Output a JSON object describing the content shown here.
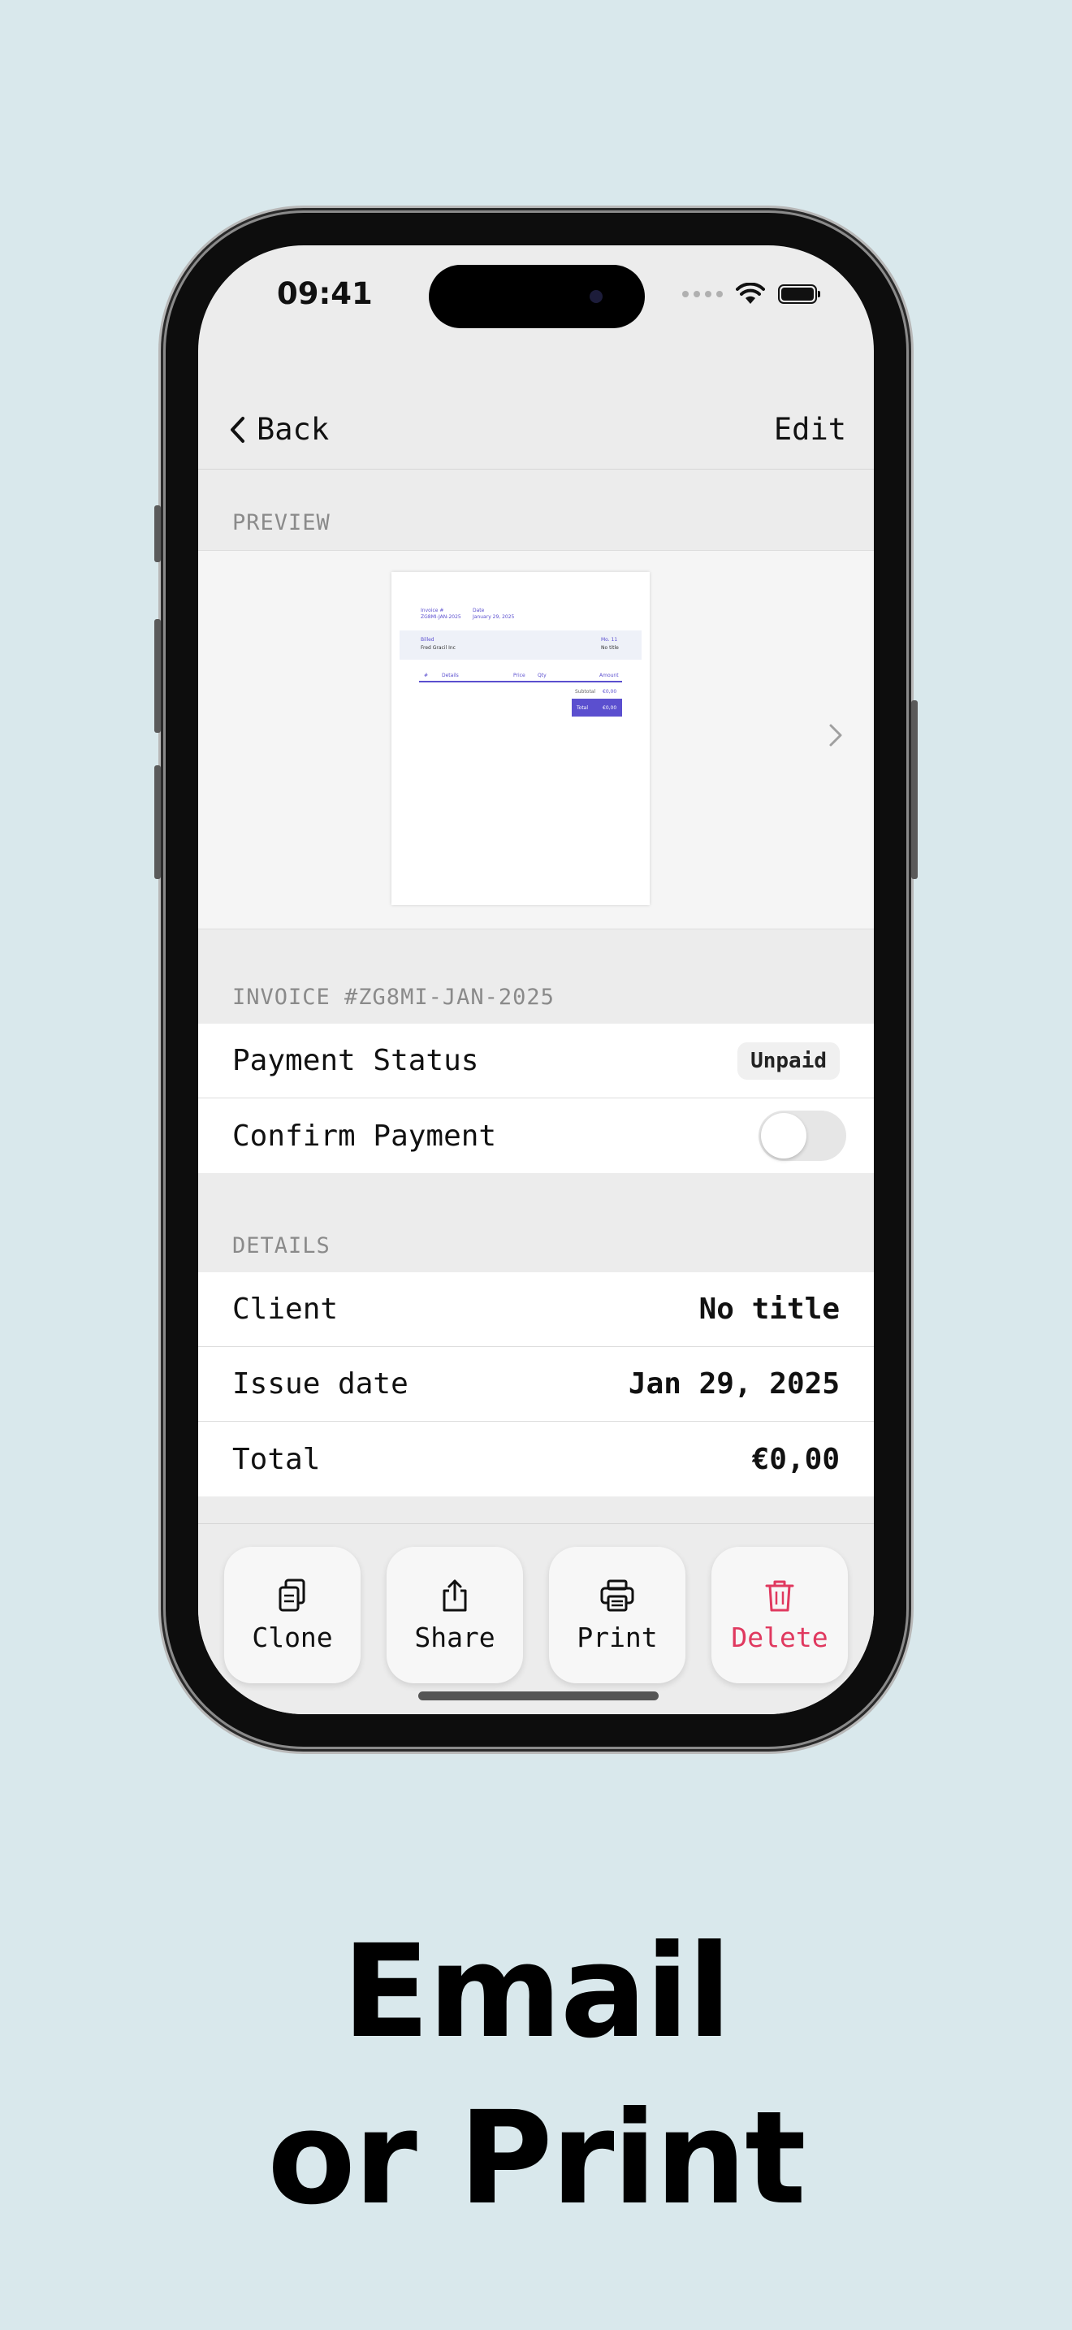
{
  "status_bar": {
    "time": "09:41"
  },
  "nav": {
    "back_label": "Back",
    "edit_label": "Edit"
  },
  "preview": {
    "section_label": "PREVIEW",
    "doc": {
      "invoice_label": "Invoice #",
      "invoice_number": "ZG8MI-JAN-2025",
      "date_label": "Date",
      "date_value": "January 29, 2025",
      "bill_label": "Billed",
      "bill_to": "Fred Gracil Inc",
      "right_top": "Mo. 11",
      "right_sub": "No title",
      "col_num": "#",
      "col_details": "Details",
      "col_price": "Price",
      "col_qty": "Qty",
      "col_amount": "Amount",
      "subtotal_label": "Subtotal",
      "subtotal_value": "€0,00",
      "total_label": "Total",
      "total_value": "€0,00",
      "accent": "#5b4fcf"
    }
  },
  "invoice": {
    "section_label": "INVOICE #ZG8MI-JAN-2025",
    "payment_status_label": "Payment Status",
    "payment_status_value": "Unpaid",
    "confirm_payment_label": "Confirm Payment",
    "confirm_payment_on": false
  },
  "details": {
    "section_label": "DETAILS",
    "rows": [
      {
        "label": "Client",
        "value": "No title"
      },
      {
        "label": "Issue date",
        "value": "Jan 29, 2025"
      },
      {
        "label": "Total",
        "value": "€0,00"
      }
    ]
  },
  "actions": [
    {
      "label": "Clone",
      "icon": "clone-icon",
      "color": "#111111"
    },
    {
      "label": "Share",
      "icon": "share-icon",
      "color": "#111111"
    },
    {
      "label": "Print",
      "icon": "print-icon",
      "color": "#111111"
    },
    {
      "label": "Delete",
      "icon": "trash-icon",
      "color": "#e0395f"
    }
  ],
  "headline": {
    "line1": "Email",
    "line2": "or Print"
  }
}
